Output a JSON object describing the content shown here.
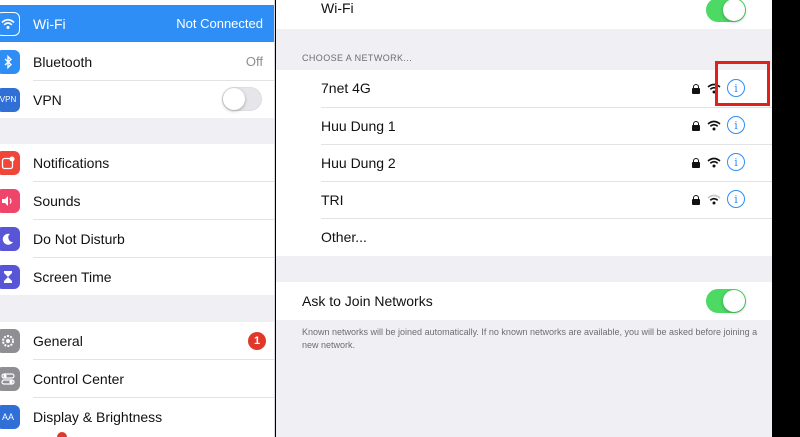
{
  "sidebar": {
    "items": [
      {
        "label": "Wi-Fi",
        "value": "Not Connected",
        "icon": "wifi-icon",
        "color": "#2f8ef5"
      },
      {
        "label": "Bluetooth",
        "value": "Off",
        "icon": "bluetooth-icon",
        "color": "#2f8ef5"
      },
      {
        "label": "VPN",
        "value": "",
        "icon": "vpn-icon",
        "color": "#2f6fd6",
        "icon_text": "VPN"
      },
      {
        "label": "Notifications",
        "value": "",
        "icon": "notifications-icon",
        "color": "#f0463a"
      },
      {
        "label": "Sounds",
        "value": "",
        "icon": "sounds-icon",
        "color": "#f0456a"
      },
      {
        "label": "Do Not Disturb",
        "value": "",
        "icon": "moon-icon",
        "color": "#5856d6"
      },
      {
        "label": "Screen Time",
        "value": "",
        "icon": "hourglass-icon",
        "color": "#5856d6"
      },
      {
        "label": "General",
        "value": "",
        "icon": "gear-icon",
        "color": "#8e8e93",
        "badge": "1"
      },
      {
        "label": "Control Center",
        "value": "",
        "icon": "switches-icon",
        "color": "#8e8e93"
      },
      {
        "label": "Display & Brightness",
        "value": "",
        "icon": "text-size-icon",
        "color": "#2f6fd6",
        "icon_text": "AA"
      }
    ],
    "vpn_toggle": "off"
  },
  "main": {
    "wifi_label": "Wi-Fi",
    "wifi_toggle": "on",
    "section_header": "CHOOSE A NETWORK...",
    "networks": [
      {
        "name": "7net 4G",
        "secured": true
      },
      {
        "name": "Huu Dung 1",
        "secured": true
      },
      {
        "name": "Huu Dung 2",
        "secured": true
      },
      {
        "name": "TRI",
        "secured": true
      }
    ],
    "other_label": "Other...",
    "ask_join_label": "Ask to Join Networks",
    "ask_join_toggle": "on",
    "footer_text": "Known networks will be joined automatically. If no known networks are available, you will be asked before joining a new network.",
    "info_glyph": "i"
  },
  "colors": {
    "accent": "#2f8ef5",
    "toggle_on": "#4cd964",
    "badge": "#e0392c",
    "highlight": "#e0201b"
  }
}
